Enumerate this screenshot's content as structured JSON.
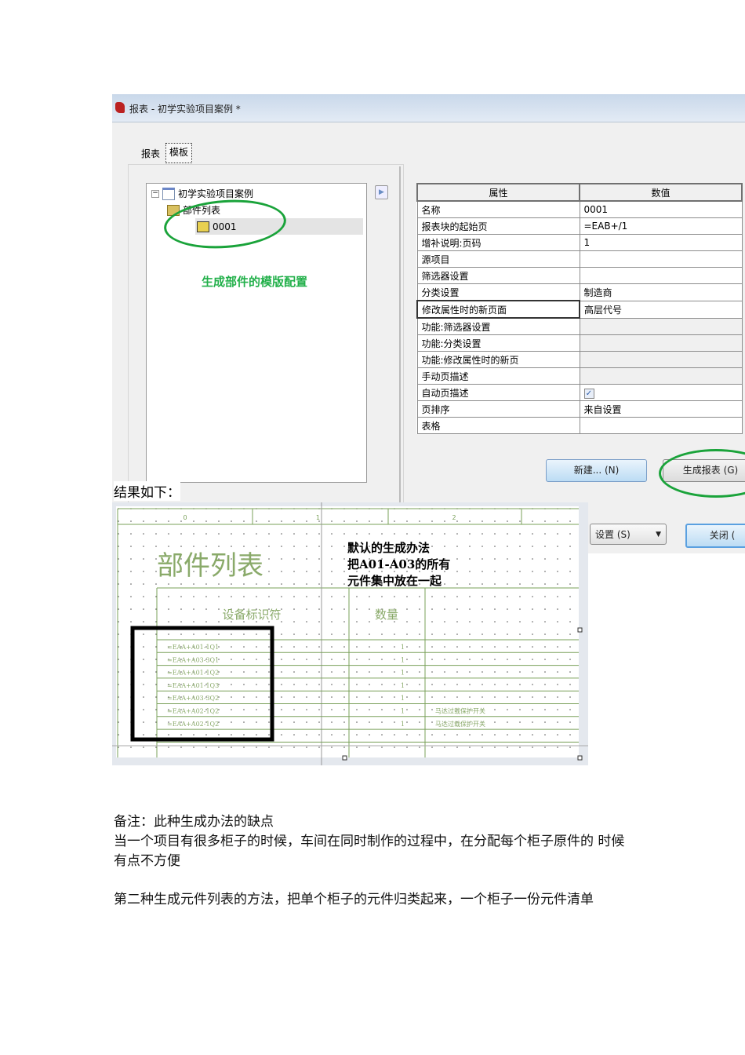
{
  "dialog": {
    "title": "报表 - 初学实验项目案例 *",
    "tabs": [
      "报表",
      "模板"
    ],
    "tree": {
      "root": "初学实验项目案例",
      "child": "部件列表",
      "leaf": "0001"
    },
    "annotation": "生成部件的模版配置",
    "table": {
      "headers": [
        "属性",
        "数值"
      ],
      "rows": [
        {
          "prop": "名称",
          "value": "0001"
        },
        {
          "prop": "报表块的起始页",
          "value": "=EAB+/1"
        },
        {
          "prop": "增补说明:页码",
          "value": "1"
        },
        {
          "prop": "源项目",
          "value": ""
        },
        {
          "prop": "筛选器设置",
          "value": ""
        },
        {
          "prop": "分类设置",
          "value": "制造商"
        },
        {
          "prop": "修改属性时的新页面",
          "value": "高层代号"
        },
        {
          "prop": "功能:筛选器设置",
          "value": ""
        },
        {
          "prop": "功能:分类设置",
          "value": ""
        },
        {
          "prop": "功能:修改属性时的新页",
          "value": ""
        },
        {
          "prop": "手动页描述",
          "value": ""
        },
        {
          "prop": "自动页描述",
          "value": ""
        },
        {
          "prop": "页排序",
          "value": "来自设置"
        },
        {
          "prop": "表格",
          "value": ""
        }
      ],
      "auto_page_checked": true
    },
    "buttons": {
      "new": "新建... (N)",
      "generate": "生成报表 (G)",
      "settings": "设置 (S)",
      "close": "关闭 ("
    }
  },
  "result_label": "结果如下：",
  "report": {
    "ruler": [
      "0",
      "1",
      "2"
    ],
    "title": "部件列表",
    "note": [
      "默认的生成办法",
      "把A01-A03的所有",
      "元件集中放在一起"
    ],
    "col_headers": [
      "设备标识符",
      "数量"
    ],
    "rows": [
      {
        "id": "=EAA+A01-1Q1",
        "qty": "1",
        "desc": ""
      },
      {
        "id": "=EAA+A03-3Q1",
        "qty": "1",
        "desc": ""
      },
      {
        "id": "=EAA+A01-1Q2",
        "qty": "1",
        "desc": ""
      },
      {
        "id": "=EAA+A01-1Q3",
        "qty": "1",
        "desc": ""
      },
      {
        "id": "=EAA+A03-3Q2",
        "qty": "1",
        "desc": ""
      },
      {
        "id": "=EAA+A02-1Q2",
        "qty": "1",
        "desc": "马达过载保护开关"
      },
      {
        "id": "=EAA+A02-1Q2",
        "qty": "1",
        "desc": "马达过载保护开关"
      }
    ]
  },
  "paragraphs": [
    "备注：此种生成办法的缺点",
    "当一个项目有很多柜子的时候，车间在同时制作的过程中，在分配每个柜子原件的  时候有点不方便",
    "第二种生成元件列表的方法，把单个柜子的元件归类起来，一个柜子一份元件清单"
  ]
}
